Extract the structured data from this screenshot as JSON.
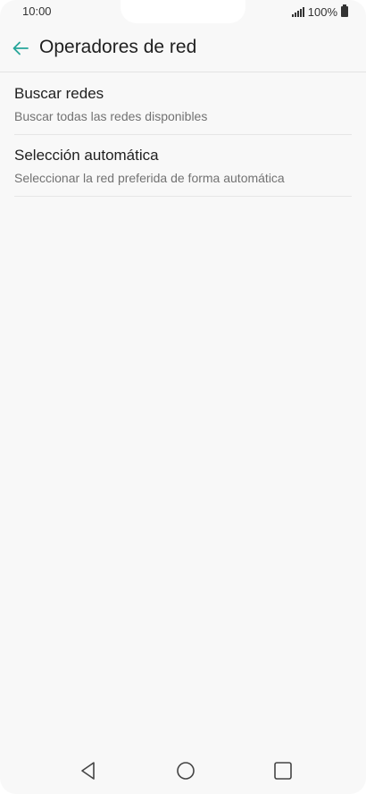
{
  "status_bar": {
    "time": "10:00",
    "battery_text": "100%",
    "icons": [
      "signal-icon",
      "battery-icon"
    ]
  },
  "app_bar": {
    "title": "Operadores de red",
    "back_icon": "arrow-back-icon",
    "accent_color": "#26a69a"
  },
  "list": {
    "items": [
      {
        "title": "Buscar redes",
        "subtitle": "Buscar todas las redes disponibles"
      },
      {
        "title": "Selección automática",
        "subtitle": "Seleccionar la red preferida de forma automática"
      }
    ]
  },
  "nav_bar": {
    "icons": [
      "back-triangle-icon",
      "home-circle-icon",
      "recents-square-icon"
    ]
  }
}
